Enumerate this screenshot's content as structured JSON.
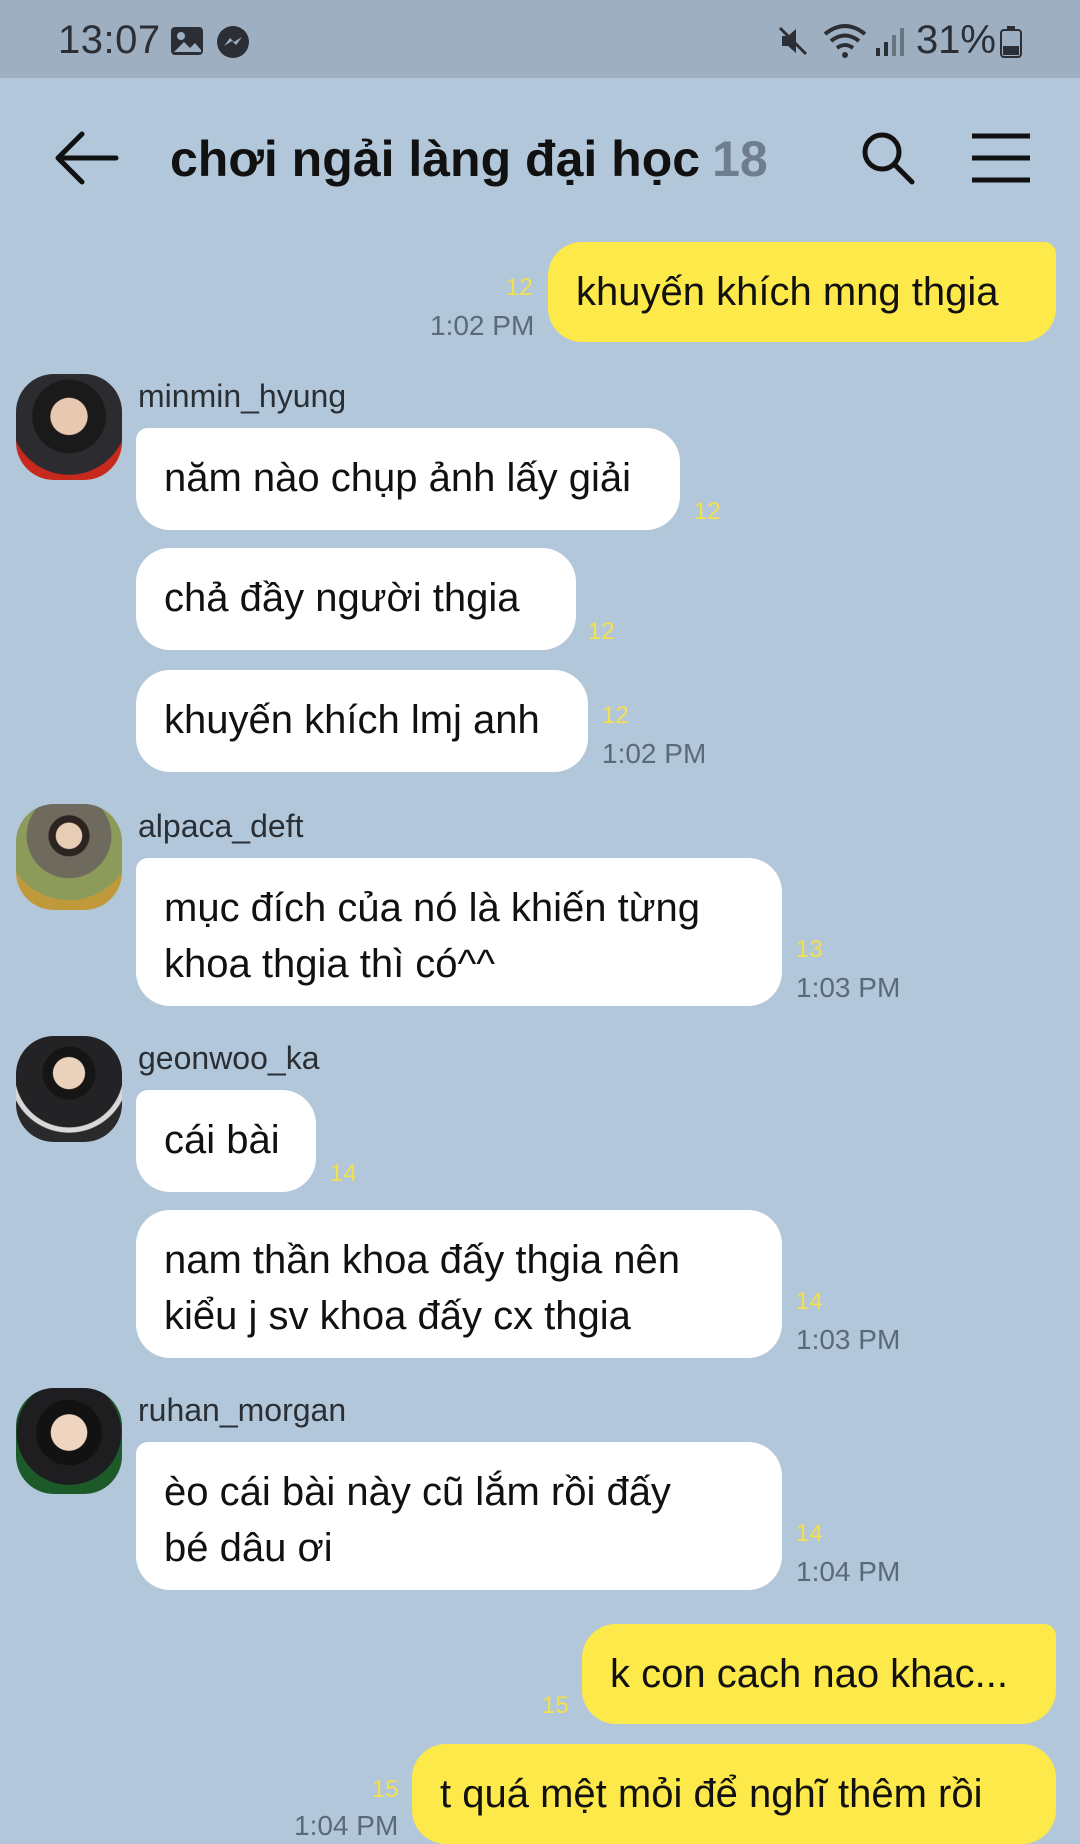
{
  "status_bar": {
    "time": "13:07",
    "battery": "31%",
    "icons": [
      "gallery-icon",
      "messenger-icon",
      "mute-icon",
      "wifi-icon",
      "signal-icon",
      "battery-icon"
    ]
  },
  "header": {
    "title": "chơi ngải làng đại học",
    "member_count": "18"
  },
  "messages": [
    {
      "from": "me",
      "text": "khuyến khích mng thgia",
      "unread": "12",
      "time": "1:02 PM"
    },
    {
      "from": "minmin_hyung",
      "text": "năm nào chụp ảnh lấy giải",
      "unread": "12"
    },
    {
      "from": "minmin_hyung",
      "text": "chả đầy người thgia",
      "unread": "12"
    },
    {
      "from": "minmin_hyung",
      "text": "khuyến khích lmj anh",
      "unread": "12",
      "time": "1:02 PM"
    },
    {
      "from": "alpaca_deft",
      "lines": [
        "mục đích của nó là khiến từng",
        "khoa thgia thì có^^"
      ],
      "unread": "13",
      "time": "1:03 PM"
    },
    {
      "from": "geonwoo_ka",
      "text": "cái bài",
      "unread": "14"
    },
    {
      "from": "geonwoo_ka",
      "lines": [
        "nam thần khoa đấy thgia nên",
        "kiểu j sv khoa đấy cx thgia"
      ],
      "unread": "14",
      "time": "1:03 PM"
    },
    {
      "from": "ruhan_morgan",
      "lines": [
        "èo cái bài này cũ lắm rồi đấy",
        "bé dâu ơi"
      ],
      "unread": "14",
      "time": "1:04 PM"
    },
    {
      "from": "me",
      "text": "k con cach nao khac...",
      "unread": "15"
    },
    {
      "from": "me",
      "text": "t quá mệt mỏi để nghĩ thêm rồi",
      "unread": "15",
      "time": "1:04 PM"
    }
  ],
  "senders": {
    "minmin": "minmin_hyung",
    "alpaca": "alpaca_deft",
    "geonwoo": "geonwoo_ka",
    "ruhan": "ruhan_morgan"
  },
  "colors": {
    "background": "#b2c7da",
    "status_bar": "#9eafc2",
    "my_bubble": "#fee94b",
    "their_bubble": "#ffffff",
    "unread_count": "#f3e04d"
  }
}
